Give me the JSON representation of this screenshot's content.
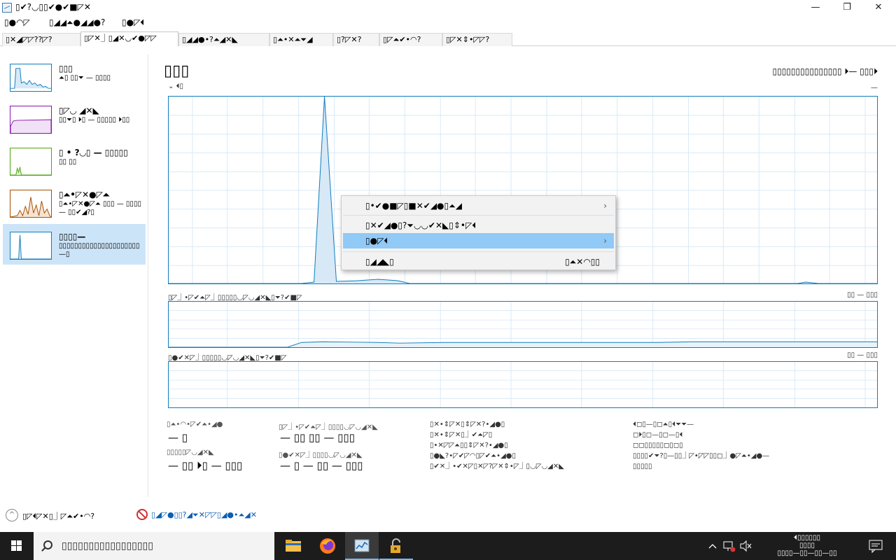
{
  "window": {
    "title": "▯✔?◡▯▯✔●✔■◸✕",
    "minimize_glyph": "—",
    "maximize_glyph": "❐",
    "close_glyph": "✕"
  },
  "menu": [
    "▯●◠◸",
    "▯◢◢⏶●◢◢●?",
    "▯●◸⏴"
  ],
  "tabs": [
    {
      "label": "▯✕◢◸◸??◸?",
      "active": false
    },
    {
      "label": "▯◸✕⏌▯◢✕◡✔●◸◸",
      "active": true
    },
    {
      "label": "▯◢◢●•?⏶◢✕◣",
      "active": false
    },
    {
      "label": "▯⏶•✕⏶⏷◢",
      "active": false
    },
    {
      "label": "▯?◸✕?",
      "active": false
    },
    {
      "label": "▯◸⏶✔•◠?",
      "active": false
    },
    {
      "label": "▯◸✕⇕•◸◸?",
      "active": false
    }
  ],
  "sidebar": {
    "items": [
      {
        "title": "▯▯▯",
        "subtitle": "⏶▯ ▯▯⏷ — ▯▯▯▯",
        "color": "#117dbb",
        "active": false
      },
      {
        "title": "▯◸◡ ◢✕◣",
        "subtitle": "▯▯⏷▯ ⏵▯ — ▯▯▯▯▯ ⏵▯▯",
        "color": "#8b12ae",
        "active": false
      },
      {
        "title": "▯ • ?◡▯ — ▯▯▯▯▯",
        "subtitle": "▯▯ ▯▯",
        "color": "#4da60c",
        "active": false
      },
      {
        "title": "▯⏶•◸✕●◸⏶",
        "subtitle": "▯⏶•◸✕●◸⏶ ▯▯▯ — ▯▯▯▯ — ▯▯✔◢?▯",
        "color": "#a74f01",
        "active": false
      },
      {
        "title": "▯▯▯▯—",
        "subtitle": "▯▯▯▯▯▯▯▯▯▯▯▯▯▯▯▯▯▯▯▯▯ —▯",
        "color": "#117dbb",
        "active": true
      }
    ]
  },
  "main": {
    "title": "▯▯▯",
    "subtitle": "▯▯▯▯▯▯▯▯▯▯▯▯▯▯▯ ⏵— ▯▯▯⏵",
    "graph_top_label": "⌄ ⏴▯",
    "graph_top_right": "—",
    "graph2_label": "▯◸⏌•◸✔⏶◸⏌▯▯▯▯▯◡◸◡◢✕◣▯⏷?✔■◸",
    "graph2_right": "▯▯ — ▯▯▯",
    "graph3_label": "▯●✔✕◸⏌▯▯▯▯▯◡◸◡◢✕◣▯⏷?✔■◸",
    "graph3_right": "▯▯ — ▯▯▯"
  },
  "stats": {
    "s1_label": "▯⏶•◠•◸✔⏶•◢●",
    "s1_value": "— ▯",
    "s2_label": "▯◸⏌•◸✔⏶◸⏌▯▯▯▯◡◸◡◢✕◣",
    "s2_value": "— ▯▯ ▯▯ — ▯▯▯",
    "s3_label": "▯▯▯▯▯◸◡◢✕◣",
    "s3_value": "— ▯▯ ⏵▯ — ▯▯▯",
    "s4_label": "▯●✔✕◸⏌▯▯▯▯◡◸◡◢✕◣",
    "s4_value": "— ▯ — ▯▯ — ▯▯▯",
    "list1": [
      "▯✕•⇕◸✕▯⇕◸✕?•◢●▯",
      "▯✕•⇕◸✕▯⏌✔⏶◸▯",
      "▯•✕◸◸⏶▯▯⇕◸✕?•◢●▯",
      "▯●◣?•◸✔◸◠▯◸✔⏶•◢●▯",
      "▯✔✕⏌•✔✕◸▯✕◸?◸✕⇕•◸⏌▯◡◸◡◢✕◣"
    ],
    "list2": [
      "⏴◻▯—▯◻⏶▯⏴⏷⏷—",
      "◻⏵▯◻—▯◻—▯⏴",
      "◻◻▯▯▯▯▯◻▯◻▯",
      "▯▯▯▯✔⏷?▯—▯▯⏌◸•◸◸▯▯◻⏌●◸⏶•◢●—",
      "▯▯▯▯▯"
    ]
  },
  "footer": {
    "fewer_details": "▯◸⏴◸✕▯⏌◸⏶✔•◠?",
    "open_link": "▯◢◸●▯▯?◢⏷✕◸◸▯◢●•⏶◢✕"
  },
  "context_menu": {
    "items": [
      {
        "label": "▯•✔●■◸▯■✕✔◢●▯⏶◢",
        "has_submenu": true,
        "highlighted": false
      },
      {
        "label": "▯✕✔◢●▯?⏷◡◡✔✕◣▯⇕•◸⏴",
        "has_submenu": false,
        "highlighted": false
      },
      {
        "label": "▯●◸⏴",
        "has_submenu": true,
        "highlighted": true
      },
      {
        "label": "▯◢◢◣▯",
        "has_submenu": false,
        "highlighted": false,
        "shortcut": "▯⏶✕◠▯▯"
      }
    ]
  },
  "taskbar": {
    "search_placeholder": "▯▯▯▯▯▯▯▯▯▯▯▯▯▯▯▯▯",
    "clock_time": "⏴▯▯▯▯▯▯",
    "clock_label": "▯▯▯▯",
    "clock_date": "▯▯▯▯—▯▯—▯▯—▯▯"
  },
  "chart_data": {
    "type": "area",
    "title": "",
    "xlabel": "",
    "ylabel": "",
    "ylim": [
      0,
      100
    ],
    "x": [
      0,
      3,
      6,
      9,
      12,
      15,
      18,
      21,
      24,
      27,
      30,
      33,
      36,
      39,
      42,
      45,
      48,
      51,
      54,
      57,
      60
    ],
    "series": [
      {
        "values": [
          0,
          0,
          0,
          0,
          0,
          0,
          0,
          0,
          0,
          0,
          0,
          0,
          0,
          0,
          0,
          0,
          0,
          0,
          0,
          0,
          0
        ]
      }
    ]
  }
}
